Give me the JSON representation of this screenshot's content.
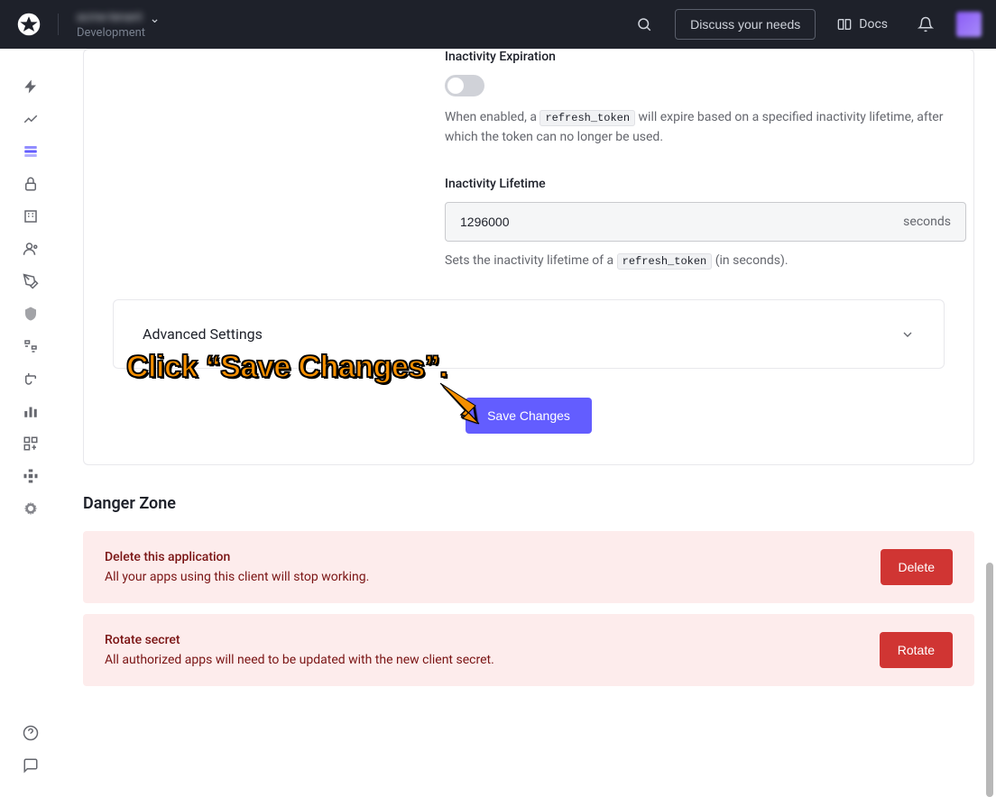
{
  "header": {
    "tenant_name": "acme-tenant",
    "environment": "Development",
    "discuss_label": "Discuss your needs",
    "docs_label": "Docs"
  },
  "settings": {
    "inactivity_expiration_label": "Inactivity Expiration",
    "inactivity_expiration_help_pre": "When enabled, a ",
    "inactivity_expiration_help_code": "refresh_token",
    "inactivity_expiration_help_post": " will expire based on a specified inactivity lifetime, after which the token can no longer be used.",
    "inactivity_lifetime_label": "Inactivity Lifetime",
    "inactivity_lifetime_value": "1296000",
    "inactivity_lifetime_unit": "seconds",
    "inactivity_lifetime_help_pre": "Sets the inactivity lifetime of a ",
    "inactivity_lifetime_help_code": "refresh_token",
    "inactivity_lifetime_help_post": " (in seconds).",
    "advanced_settings_label": "Advanced Settings",
    "save_button_label": "Save Changes"
  },
  "danger": {
    "section_title": "Danger Zone",
    "delete_title": "Delete this application",
    "delete_text": "All your apps using this client will stop working.",
    "delete_button": "Delete",
    "rotate_title": "Rotate secret",
    "rotate_text": "All authorized apps will need to be updated with the new client secret.",
    "rotate_button": "Rotate"
  },
  "annotation": {
    "text": "Click “Save Changes”."
  }
}
